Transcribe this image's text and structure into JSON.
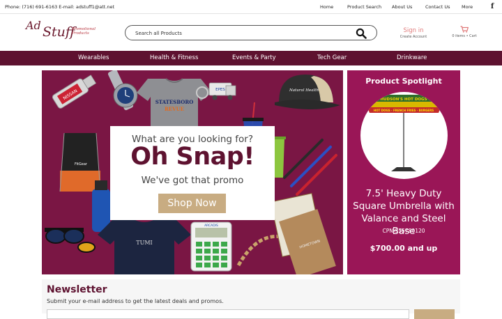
{
  "topbar": {
    "contact": "Phone: (716) 691-6163 E-mail: adstuff1@att.net",
    "nav": [
      "Home",
      "Product Search",
      "About Us",
      "Contact Us",
      "More"
    ],
    "facebook_icon": "facebook-icon"
  },
  "header": {
    "logo": {
      "word1": "Ad",
      "word2": "Stuff",
      "tag1": "Promotional",
      "tag2": "Products"
    },
    "search_placeholder": "Search all Products",
    "signin_label": "Sign in",
    "create_account_label": "Create Account",
    "cart_label": "0 items • Cart"
  },
  "categories": [
    "Wearables",
    "Health & Fitness",
    "Events & Party",
    "Tech Gear",
    "Drinkware"
  ],
  "hero": {
    "question": "What are you looking for?",
    "headline": "Oh Snap!",
    "subline": "We've got that promo",
    "button_label": "Shop Now",
    "product_texts": {
      "usb": "NISSAN",
      "tshirt": "STATESBORO REVUE",
      "cap": "Natural Health",
      "truck": "EPES",
      "navy_tee": "TUMI",
      "calculator_brand": "ARCADIS",
      "calculator_display": "123456789",
      "backpack": "FitGear",
      "notebook": "HOMETOWN"
    }
  },
  "spotlight": {
    "heading": "Product Spotlight",
    "umbrella_banner": "HUDSON'S HOT DOGS",
    "umbrella_valance": "HOT DOGS · FRENCH FRIES · BURGERS",
    "product_name": "7.5' Heavy Duty Square Umbrella with Valance and Steel Base",
    "sku": "CPN-555780120",
    "price": "$700.00 and up"
  },
  "newsletter": {
    "heading": "Newsletter",
    "description": "Submit your e-mail address to get the latest deals and promos."
  },
  "colors": {
    "brand": "#5e1230",
    "hero_bg": "#7a1644",
    "spotlight_bg": "#9a1657",
    "button": "#c8ac82",
    "signin": "#e07b7b"
  }
}
